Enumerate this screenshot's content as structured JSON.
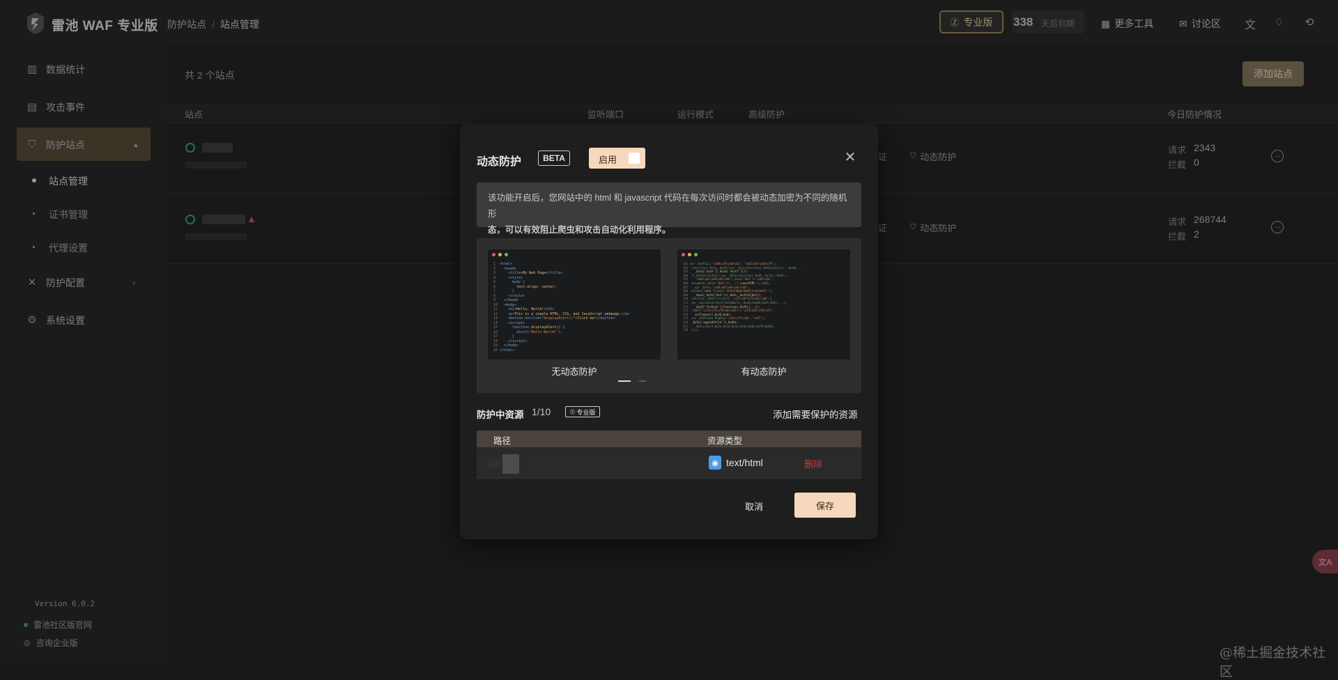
{
  "app": {
    "logo_text": "雷池 WAF 专业版",
    "breadcrumb": [
      "防护站点",
      "站点管理"
    ]
  },
  "topbar": {
    "pro_label": "专业版",
    "count_value": "338",
    "count_label": "天后到期",
    "more_tools": "更多工具",
    "forum": "讨论区"
  },
  "sidebar": {
    "items": [
      {
        "label": "数据统计",
        "icon": "bar-chart-icon"
      },
      {
        "label": "攻击事件",
        "icon": "calendar-icon"
      },
      {
        "label": "防护站点",
        "icon": "shield-icon"
      },
      {
        "label": "防护配置",
        "icon": "tools-icon"
      },
      {
        "label": "系统设置",
        "icon": "gear-icon"
      }
    ],
    "sub_items": [
      "站点管理",
      "证书管理",
      "代理设置"
    ],
    "version": "Version 6.0.2",
    "links": [
      "雷池社区版官网",
      "咨询企业版"
    ]
  },
  "main": {
    "site_count": "共 2 个站点",
    "add_site_label": "添加站点",
    "columns": [
      "站点",
      "监听端口",
      "运行模式",
      "高级防护",
      "今日防护情况"
    ],
    "rows": [
      {
        "cert": "证",
        "dynamic": "动态防护",
        "req_label": "请求",
        "req": "2343",
        "block_label": "拦截",
        "block": "0"
      },
      {
        "cert": "证",
        "dynamic": "动态防护",
        "req_label": "请求",
        "req": "268744",
        "block_label": "拦截",
        "block": "2"
      }
    ]
  },
  "modal": {
    "title": "动态防护",
    "beta": "BETA",
    "toggle_label": "启用",
    "toggle_on": true,
    "info_line1": "该功能开启后，您网站中的 html 和 javascript 代码在每次访问时都会被动态加密为不同的随机形",
    "info_line2": "态，可以有效阻止爬虫和攻击自动化利用程序。",
    "preview_left_caption": "无动态防护",
    "preview_right_caption": "有动态防护",
    "carousel_active_index": 0,
    "resources_title": "防护中资源",
    "resources_count": "1/10",
    "pro_tag": "专业版",
    "add_resource": "添加需要保护的资源",
    "table_headers": [
      "路径",
      "资源类型"
    ],
    "table_rows": [
      {
        "type": "text/html",
        "action": "删除"
      }
    ],
    "cancel": "取消",
    "save": "保存"
  },
  "watermark": "@稀土掘金技术社区",
  "colors": {
    "accent": "#f6d8bd",
    "danger": "#c63a3a",
    "overlay_bg": "#181818",
    "modal_bg": "#1e1e1e"
  }
}
